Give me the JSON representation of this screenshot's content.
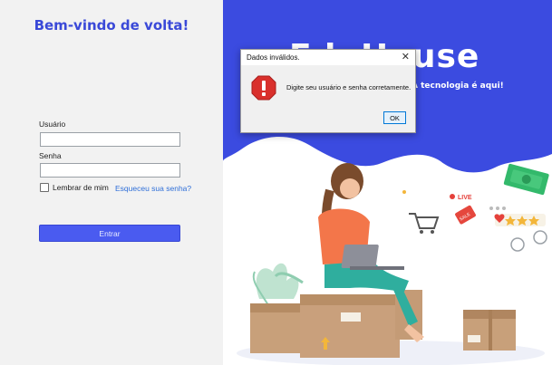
{
  "login": {
    "welcome": "Bem-vindo de volta!",
    "user_label": "Usuário",
    "user_value": "",
    "pass_label": "Senha",
    "pass_value": "",
    "remember_label": "Lembrar de mim",
    "forgot_link": "Esqueceu sua senha?",
    "submit_label": "Entrar"
  },
  "hero": {
    "brand_title": "EduHouse",
    "brand_subtitle": "A tecnologia é aqui!",
    "illustration_tags": {
      "live": "LIVE",
      "sale": "SALE"
    }
  },
  "dialog": {
    "title": "Dados inválidos.",
    "close_icon": "close-icon",
    "error_icon": "error-icon",
    "message": "Digite seu usuário e senha corretamente.",
    "ok_label": "OK"
  },
  "colors": {
    "accent": "#3a49d8",
    "button": "#4a5bf0",
    "hero_blue": "#3b4be0",
    "error_red": "#d9302c"
  }
}
